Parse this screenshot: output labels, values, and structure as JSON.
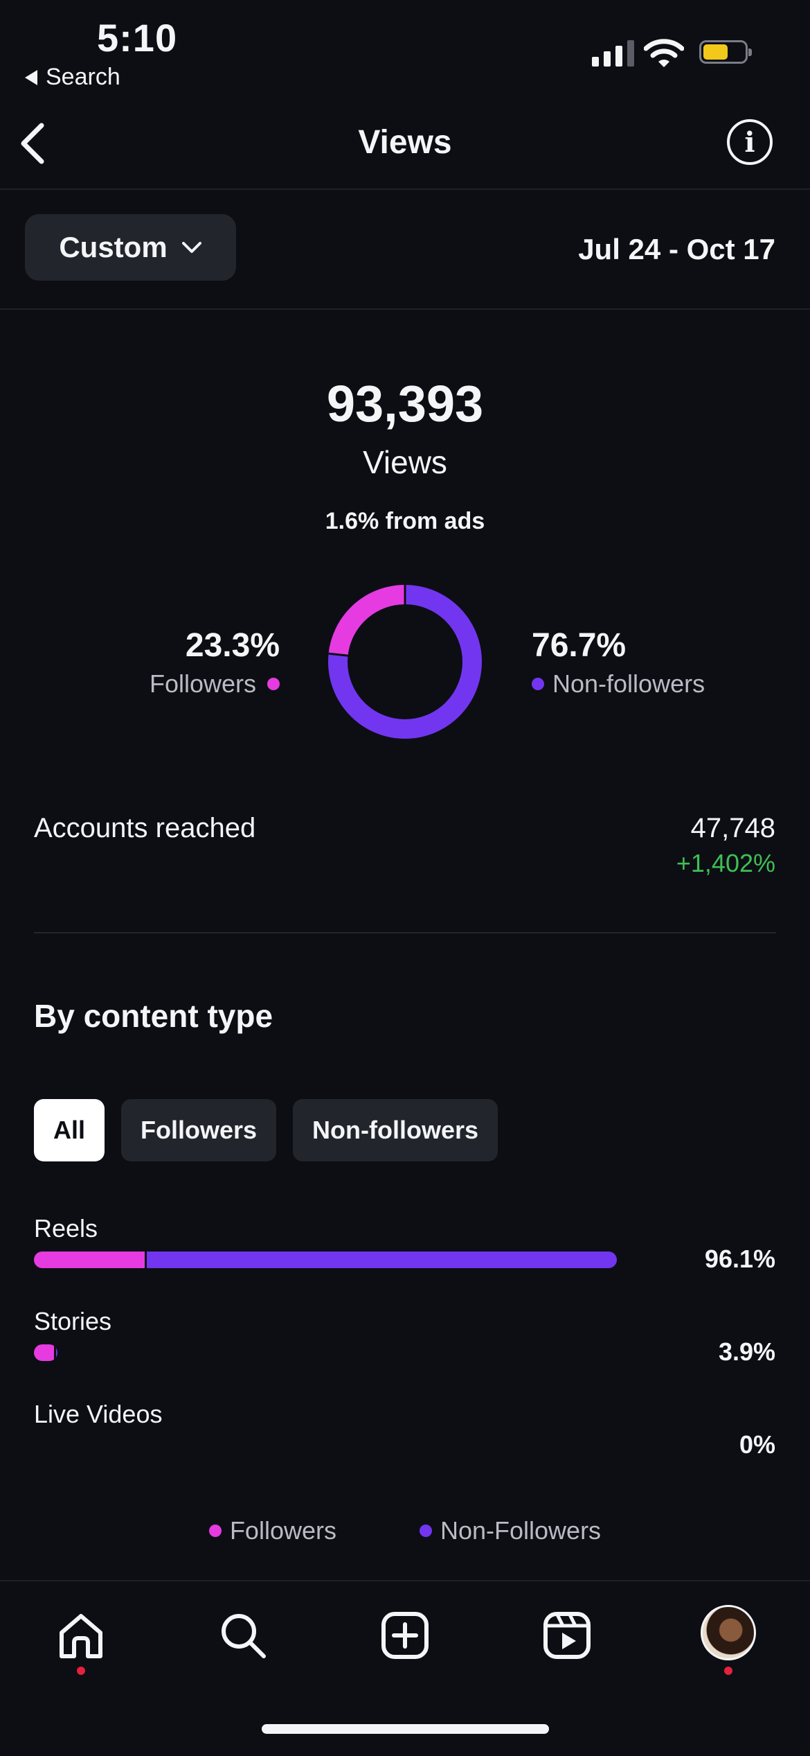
{
  "status_bar": {
    "time": "5:10",
    "back_app": "Search"
  },
  "header": {
    "title": "Views"
  },
  "filter": {
    "period_label": "Custom",
    "date_range": "Jul 24 - Oct 17"
  },
  "summary": {
    "views": "93,393",
    "views_label": "Views",
    "ads_note": "1.6% from ads",
    "followers_pct": "23.3%",
    "followers_label": "Followers",
    "non_followers_pct": "76.7%",
    "non_followers_label": "Non-followers",
    "followers_share": 0.233
  },
  "accounts_reached": {
    "label": "Accounts reached",
    "value": "47,748",
    "change": "+1,402%"
  },
  "content_type": {
    "title": "By content type",
    "tabs": [
      {
        "label": "All",
        "active": true
      },
      {
        "label": "Followers",
        "active": false
      },
      {
        "label": "Non-followers",
        "active": false
      }
    ],
    "rows": [
      {
        "label": "Reels",
        "pct": "96.1%",
        "share": 0.961,
        "followers_share": 0.19
      },
      {
        "label": "Stories",
        "pct": "3.9%",
        "share": 0.039,
        "followers_share": 0.85
      },
      {
        "label": "Live Videos",
        "pct": "0%",
        "share": 0.0,
        "followers_share": 0.0
      }
    ],
    "legend": {
      "followers": "Followers",
      "non_followers": "Non-Followers"
    }
  },
  "colors": {
    "followers": "#e63be0",
    "non_followers": "#7236f0",
    "positive": "#3fbf55",
    "notification": "#e5213d"
  },
  "bottom_nav": {
    "items": [
      {
        "icon": "home-icon"
      },
      {
        "icon": "search-icon"
      },
      {
        "icon": "create-icon"
      },
      {
        "icon": "reels-icon"
      },
      {
        "icon": "profile-avatar"
      }
    ]
  }
}
